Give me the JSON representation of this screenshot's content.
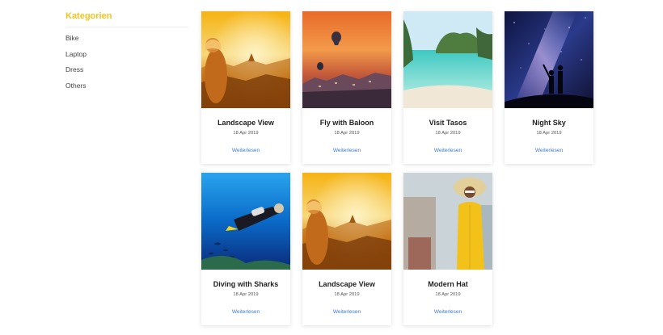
{
  "sidebar": {
    "title": "Kategorien",
    "items": [
      {
        "label": "Bike"
      },
      {
        "label": "Laptop"
      },
      {
        "label": "Dress"
      },
      {
        "label": "Others"
      }
    ]
  },
  "posts": [
    {
      "title": "Landscape View",
      "date": "18 Apr 2019",
      "link": "Weiterlesen",
      "image": "landscape-sunset-image"
    },
    {
      "title": "Fly with Baloon",
      "date": "18 Apr 2019",
      "link": "Weiterlesen",
      "image": "hot-air-balloon-image"
    },
    {
      "title": "Visit Tasos",
      "date": "18 Apr 2019",
      "link": "Weiterlesen",
      "image": "tropical-beach-image"
    },
    {
      "title": "Night Sky",
      "date": "18 Apr 2019",
      "link": "Weiterlesen",
      "image": "milky-way-image"
    },
    {
      "title": "Diving with Sharks",
      "date": "18 Apr 2019",
      "link": "Weiterlesen",
      "image": "scuba-diver-image"
    },
    {
      "title": "Landscape View",
      "date": "18 Apr 2019",
      "link": "Weiterlesen",
      "image": "landscape-sunset-image"
    },
    {
      "title": "Modern Hat",
      "date": "18 Apr 2019",
      "link": "Weiterlesen",
      "image": "woman-hat-image"
    }
  ],
  "colors": {
    "accent": "#f4c31c",
    "link": "#3b7ad8"
  }
}
